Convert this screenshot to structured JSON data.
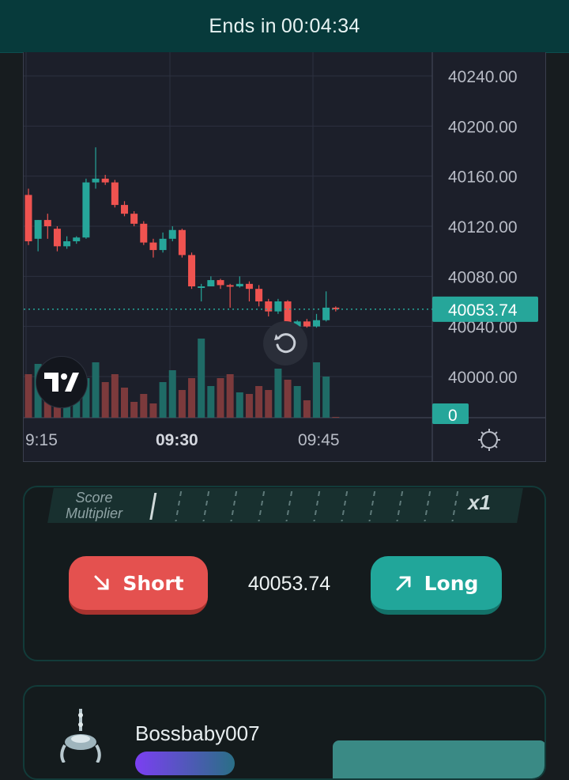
{
  "header": {
    "prefix": "Ends in",
    "countdown": "00:04:34"
  },
  "chart_data": {
    "type": "candlestick",
    "y_ticks": [
      "40240.00",
      "40200.00",
      "40160.00",
      "40120.00",
      "40080.00",
      "40040.00",
      "40000.00"
    ],
    "ylim": [
      39990,
      40260
    ],
    "x_ticks": [
      {
        "label": "9:15",
        "bold": false
      },
      {
        "label": "09:30",
        "bold": true
      },
      {
        "label": "09:45",
        "bold": false
      }
    ],
    "current_price_label": "40053.74",
    "current_price": 40053.74,
    "volume_label": "0",
    "colors": {
      "up": "#26a69a",
      "down": "#ef5350",
      "up_vol": "#1f6b66",
      "down_vol": "#7c3a3c",
      "grid": "#2c3040"
    },
    "candles": [
      {
        "o": 40145,
        "h": 40150,
        "l": 40105,
        "c": 40108,
        "v": 0.55
      },
      {
        "o": 40110,
        "h": 40125,
        "l": 40100,
        "c": 40125,
        "v": 0.68
      },
      {
        "o": 40125,
        "h": 40130,
        "l": 40110,
        "c": 40120,
        "v": 0.35
      },
      {
        "o": 40118,
        "h": 40120,
        "l": 40100,
        "c": 40104,
        "v": 0.3
      },
      {
        "o": 40104,
        "h": 40112,
        "l": 40102,
        "c": 40108,
        "v": 0.22
      },
      {
        "o": 40108,
        "h": 40112,
        "l": 40106,
        "c": 40111,
        "v": 0.42
      },
      {
        "o": 40111,
        "h": 40158,
        "l": 40110,
        "c": 40155,
        "v": 0.5
      },
      {
        "o": 40155,
        "h": 40183,
        "l": 40150,
        "c": 40158,
        "v": 0.7
      },
      {
        "o": 40158,
        "h": 40161,
        "l": 40153,
        "c": 40155,
        "v": 0.45
      },
      {
        "o": 40155,
        "h": 40157,
        "l": 40135,
        "c": 40137,
        "v": 0.55
      },
      {
        "o": 40137,
        "h": 40140,
        "l": 40128,
        "c": 40130,
        "v": 0.38
      },
      {
        "o": 40130,
        "h": 40132,
        "l": 40120,
        "c": 40122,
        "v": 0.2
      },
      {
        "o": 40122,
        "h": 40124,
        "l": 40105,
        "c": 40107,
        "v": 0.3
      },
      {
        "o": 40107,
        "h": 40110,
        "l": 40095,
        "c": 40101,
        "v": 0.18
      },
      {
        "o": 40101,
        "h": 40115,
        "l": 40099,
        "c": 40110,
        "v": 0.45
      },
      {
        "o": 40110,
        "h": 40120,
        "l": 40108,
        "c": 40117,
        "v": 0.6
      },
      {
        "o": 40117,
        "h": 40118,
        "l": 40095,
        "c": 40097,
        "v": 0.35
      },
      {
        "o": 40097,
        "h": 40099,
        "l": 40070,
        "c": 40072,
        "v": 0.5
      },
      {
        "o": 40072,
        "h": 40074,
        "l": 40060,
        "c": 40072,
        "v": 1.0
      },
      {
        "o": 40072,
        "h": 40080,
        "l": 40072,
        "c": 40077,
        "v": 0.4
      },
      {
        "o": 40077,
        "h": 40078,
        "l": 40070,
        "c": 40073,
        "v": 0.5
      },
      {
        "o": 40073,
        "h": 40074,
        "l": 40055,
        "c": 40072,
        "v": 0.55
      },
      {
        "o": 40072,
        "h": 40080,
        "l": 40071,
        "c": 40074,
        "v": 0.32
      },
      {
        "o": 40074,
        "h": 40076,
        "l": 40060,
        "c": 40070,
        "v": 0.3
      },
      {
        "o": 40070,
        "h": 40073,
        "l": 40056,
        "c": 40060,
        "v": 0.4
      },
      {
        "o": 40060,
        "h": 40062,
        "l": 40048,
        "c": 40052,
        "v": 0.35
      },
      {
        "o": 40052,
        "h": 40062,
        "l": 40050,
        "c": 40060,
        "v": 0.62
      },
      {
        "o": 40060,
        "h": 40061,
        "l": 40035,
        "c": 40040,
        "v": 0.48
      },
      {
        "o": 40040,
        "h": 40045,
        "l": 40038,
        "c": 40044,
        "v": 0.4
      },
      {
        "o": 40044,
        "h": 40046,
        "l": 40039,
        "c": 40040,
        "v": 0.22
      },
      {
        "o": 40040,
        "h": 40050,
        "l": 40039,
        "c": 40045,
        "v": 0.7
      },
      {
        "o": 40045,
        "h": 40068,
        "l": 40044,
        "c": 40055,
        "v": 0.52
      },
      {
        "o": 40055,
        "h": 40056,
        "l": 40052,
        "c": 40054,
        "v": 0.01
      }
    ]
  },
  "score": {
    "label_line1": "Score",
    "label_line2": "Multiplier",
    "multiplier": "x1"
  },
  "trade": {
    "short_label": "Short",
    "long_label": "Long",
    "price": "40053.74"
  },
  "user": {
    "username": "Bossbaby007"
  }
}
